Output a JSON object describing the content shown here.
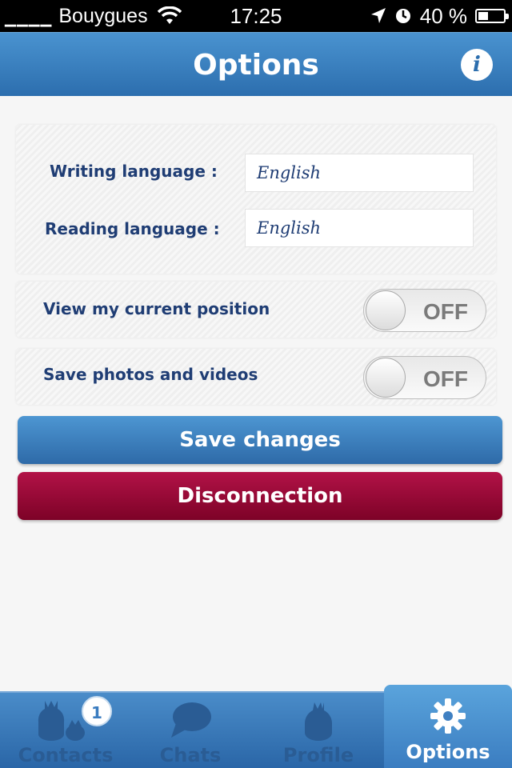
{
  "status_bar": {
    "signal": "▁▁▁▁",
    "carrier": "Bouygues",
    "time": "17:25",
    "battery": "40 %",
    "battery_level": 0.4
  },
  "header": {
    "title": "Options",
    "info_label": "i"
  },
  "languages": {
    "writing_label": "Writing language :",
    "writing_value": "English",
    "reading_label": "Reading language :",
    "reading_value": "English"
  },
  "toggles": [
    {
      "label": "View my current position",
      "state": "OFF"
    },
    {
      "label": "Save photos and videos",
      "state": "OFF"
    }
  ],
  "buttons": {
    "save": "Save changes",
    "disconnect": "Disconnection"
  },
  "tabbar": {
    "tabs": [
      {
        "label": "Contacts",
        "icon": "birds-icon",
        "badge": "1"
      },
      {
        "label": "Chats",
        "icon": "speech-bubble-icon"
      },
      {
        "label": "Profile",
        "icon": "bird-icon"
      },
      {
        "label": "Options",
        "icon": "gear-icon"
      }
    ]
  },
  "colors": {
    "primary": "#2c6eae",
    "danger": "#9c0a37",
    "text": "#1f3d74"
  }
}
